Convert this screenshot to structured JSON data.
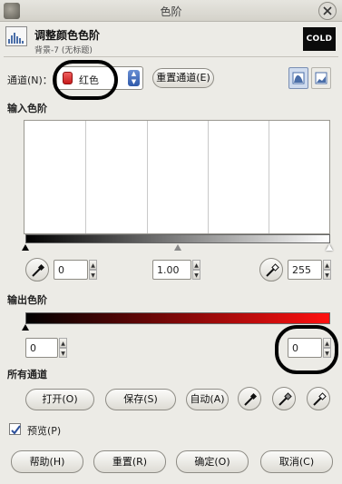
{
  "window": {
    "title": "色阶"
  },
  "header": {
    "title": "调整颜色色阶",
    "subtitle": "背景-7 (无标题)",
    "thumbnail_text": "COLD"
  },
  "channel": {
    "label": "通道(N)：",
    "selected": "红色",
    "reset_button": "重置通道(E)",
    "log_icon": "histogram-log-icon",
    "linear_icon": "histogram-linear-icon"
  },
  "input_levels": {
    "label": "输入色阶",
    "low": "0",
    "gamma": "1.00",
    "high": "255"
  },
  "output_levels": {
    "label": "输出色阶",
    "low": "0",
    "high": "0"
  },
  "all_channels": {
    "label": "所有通道",
    "open": "打开(O)",
    "save": "保存(S)",
    "auto": "自动(A)"
  },
  "preview": {
    "label": "预览(P)",
    "checked": true
  },
  "buttons": {
    "help": "帮助(H)",
    "reset": "重置(R)",
    "ok": "确定(O)",
    "cancel": "取消(C)"
  },
  "colors": {
    "accent": "#ff1010",
    "histogram_bg": "#ffffff"
  }
}
